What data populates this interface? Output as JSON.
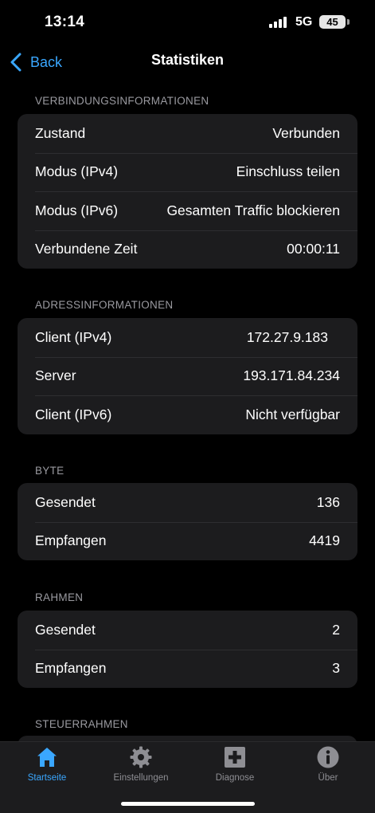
{
  "status_bar": {
    "time": "13:14",
    "network": "5G",
    "battery": "45"
  },
  "nav": {
    "back_label": "Back",
    "title": "Statistiken"
  },
  "sections": {
    "connection": {
      "header": "VERBINDUNGSINFORMATIONEN",
      "rows": [
        {
          "label": "Zustand",
          "value": "Verbunden"
        },
        {
          "label": "Modus (IPv4)",
          "value": "Einschluss teilen"
        },
        {
          "label": "Modus (IPv6)",
          "value": "Gesamten Traffic blockieren"
        },
        {
          "label": "Verbundene Zeit",
          "value": "00:00:11"
        }
      ]
    },
    "address": {
      "header": "ADRESSINFORMATIONEN",
      "rows": [
        {
          "label": "Client (IPv4)",
          "value": "172.27.9.183"
        },
        {
          "label": "Server",
          "value": "193.171.84.234"
        },
        {
          "label": "Client (IPv6)",
          "value": "Nicht verfügbar"
        }
      ]
    },
    "bytes": {
      "header": "BYTE",
      "rows": [
        {
          "label": "Gesendet",
          "value": "136"
        },
        {
          "label": "Empfangen",
          "value": "4419"
        }
      ]
    },
    "frames": {
      "header": "RAHMEN",
      "rows": [
        {
          "label": "Gesendet",
          "value": "2"
        },
        {
          "label": "Empfangen",
          "value": "3"
        }
      ]
    },
    "control_frames": {
      "header": "STEUERRAHMEN"
    }
  },
  "tabs": [
    {
      "label": "Startseite",
      "icon": "home-icon",
      "active": true
    },
    {
      "label": "Einstellungen",
      "icon": "gear-icon",
      "active": false
    },
    {
      "label": "Diagnose",
      "icon": "plus-square-icon",
      "active": false
    },
    {
      "label": "Über",
      "icon": "info-icon",
      "active": false
    }
  ],
  "colors": {
    "accent": "#3aa7ff",
    "background": "#000000",
    "cell": "#1c1c1e",
    "secondary_text": "#9a9aa0"
  }
}
